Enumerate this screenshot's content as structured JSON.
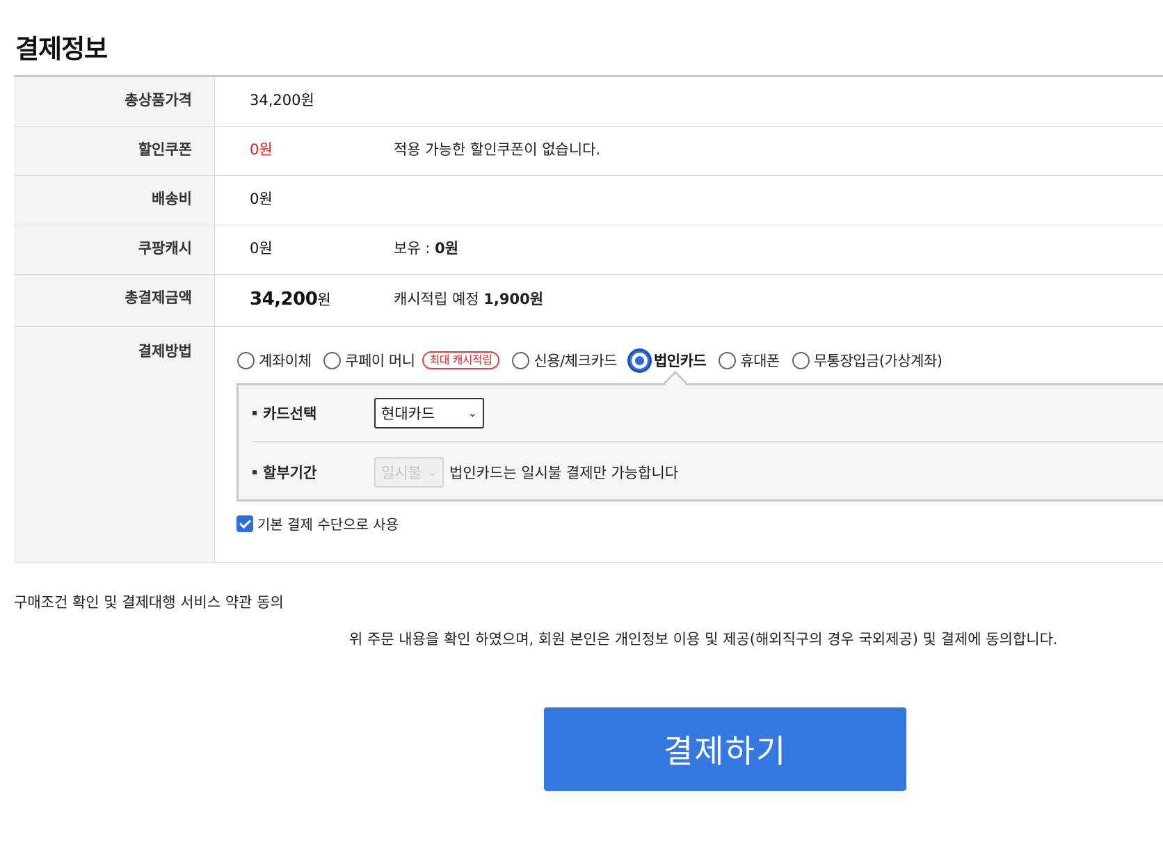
{
  "page": {
    "title": "결제정보"
  },
  "rows": {
    "total_product_price": {
      "label": "총상품가격",
      "value": "34,200원"
    },
    "discount_coupon": {
      "label": "할인쿠폰",
      "value": "0원",
      "note": "적용 가능한 할인쿠폰이 없습니다."
    },
    "shipping": {
      "label": "배송비",
      "value": "0원"
    },
    "coupang_cash": {
      "label": "쿠팡캐시",
      "value": "0원",
      "holding_label": "보유 : ",
      "holding_value": "0원"
    },
    "total_payment": {
      "label": "총결제금액",
      "amount": "34,200",
      "unit": "원",
      "cash_reward_label": "캐시적립 예정 ",
      "cash_reward_value": "1,900원"
    },
    "payment_method": {
      "label": "결제방법"
    }
  },
  "payment_methods": [
    {
      "label": "계좌이체",
      "selected": false
    },
    {
      "label": "쿠페이 머니",
      "selected": false,
      "badge": "최대 캐시적립"
    },
    {
      "label": "신용/체크카드",
      "selected": false
    },
    {
      "label": "법인카드",
      "selected": true
    },
    {
      "label": "휴대폰",
      "selected": false
    },
    {
      "label": "무통장입금(가상계좌)",
      "selected": false
    }
  ],
  "card_panel": {
    "card_select_label": "카드선택",
    "card_selected": "현대카드",
    "installment_label": "할부기간",
    "installment_selected": "일시불",
    "installment_note": "법인카드는 일시불 결제만 가능합니다"
  },
  "default_method": {
    "label": "기본 결제 수단으로 사용",
    "checked": true
  },
  "terms": {
    "title": "구매조건 확인 및 결제대행 서비스 약관 동의",
    "agreement": "위 주문 내용을 확인 하였으며, 회원 본인은 개인정보 이용 및 제공(해외직구의 경우 국외제공) 및 결제에 동의합니다."
  },
  "pay_button": {
    "label": "결제하기"
  },
  "colors": {
    "accent": "#3579e0",
    "discount_red": "#e02020",
    "label_bg": "#f4f4f4"
  }
}
